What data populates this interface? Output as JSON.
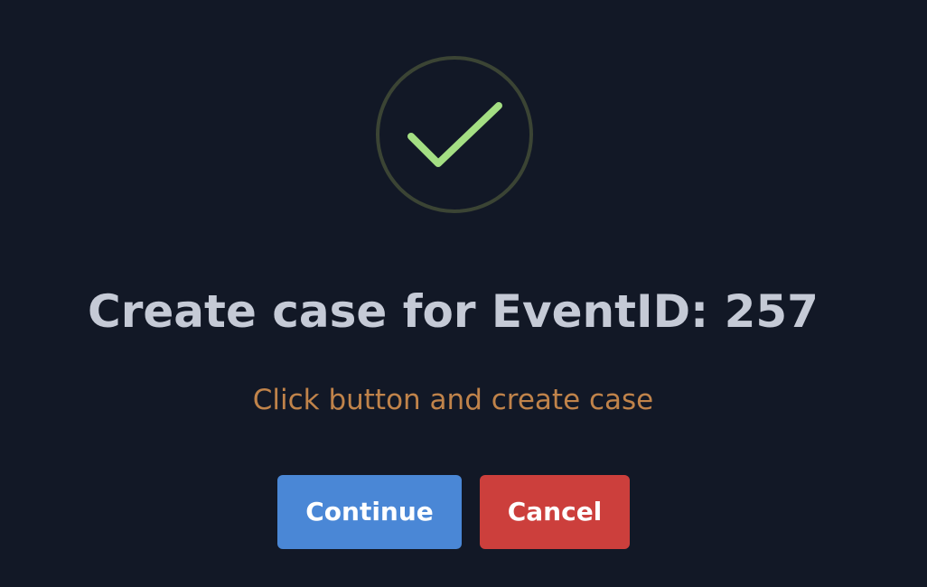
{
  "dialog": {
    "icon": "check-circle-icon",
    "title": "Create case for EventID: 257",
    "subtitle": "Click button and create case",
    "buttons": {
      "continue_label": "Continue",
      "cancel_label": "Cancel"
    }
  },
  "colors": {
    "background": "#121826",
    "title": "#c5cad6",
    "subtitle": "#c0834a",
    "check": "#a4de83",
    "icon_ring": "#3b4434",
    "continue_button": "#4a87d6",
    "cancel_button": "#cc3f3c"
  }
}
